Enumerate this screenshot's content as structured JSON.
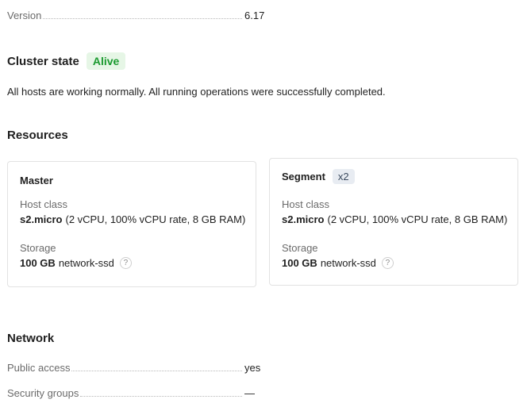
{
  "general": {
    "version_label": "Version",
    "version_value": "6.17"
  },
  "cluster_state": {
    "title": "Cluster state",
    "badge": "Alive",
    "description": "All hosts are working normally. All running operations were successfully completed."
  },
  "resources": {
    "title": "Resources",
    "master": {
      "title": "Master",
      "host_class_label": "Host class",
      "host_class_name": "s2.micro",
      "host_class_detail": "(2 vCPU, 100% vCPU rate, 8 GB RAM)",
      "storage_label": "Storage",
      "storage_size": "100 GB",
      "storage_type": "network-ssd",
      "help": "?"
    },
    "segment": {
      "title": "Segment",
      "count": "x2",
      "host_class_label": "Host class",
      "host_class_name": "s2.micro",
      "host_class_detail": "(2 vCPU, 100% vCPU rate, 8 GB RAM)",
      "storage_label": "Storage",
      "storage_size": "100 GB",
      "storage_type": "network-ssd",
      "help": "?"
    }
  },
  "network": {
    "title": "Network",
    "public_access_label": "Public access",
    "public_access_value": "yes",
    "security_groups_label": "Security groups",
    "security_groups_value": "—"
  },
  "colors": {
    "status_green": "#1a9a2f",
    "status_bg": "#e6f6e6",
    "muted_text": "#6b6b6b",
    "card_border": "#e2e2e2"
  }
}
